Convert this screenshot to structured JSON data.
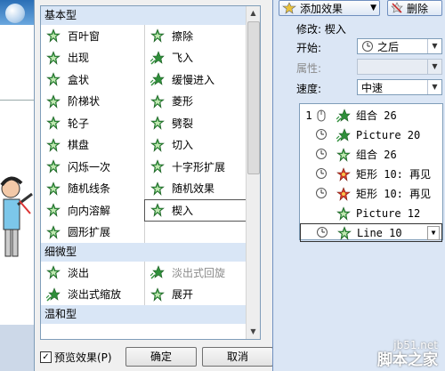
{
  "dialog": {
    "sections": [
      {
        "title": "基本型",
        "items": [
          {
            "label": "百叶窗",
            "icon": "star-effect-icon"
          },
          {
            "label": "擦除",
            "icon": "star-effect-icon"
          },
          {
            "label": "出现",
            "icon": "star-effect-icon"
          },
          {
            "label": "飞入",
            "icon": "star-fly-icon"
          },
          {
            "label": "盒状",
            "icon": "star-effect-icon"
          },
          {
            "label": "缓慢进入",
            "icon": "star-fly-icon"
          },
          {
            "label": "阶梯状",
            "icon": "star-effect-icon"
          },
          {
            "label": "菱形",
            "icon": "star-effect-icon"
          },
          {
            "label": "轮子",
            "icon": "star-effect-icon"
          },
          {
            "label": "劈裂",
            "icon": "star-effect-icon"
          },
          {
            "label": "棋盘",
            "icon": "star-effect-icon"
          },
          {
            "label": "切入",
            "icon": "star-effect-icon"
          },
          {
            "label": "闪烁一次",
            "icon": "star-effect-icon"
          },
          {
            "label": "十字形扩展",
            "icon": "star-effect-icon"
          },
          {
            "label": "随机线条",
            "icon": "star-effect-icon"
          },
          {
            "label": "随机效果",
            "icon": "star-effect-icon"
          },
          {
            "label": "向内溶解",
            "icon": "star-effect-icon"
          },
          {
            "label": "楔入",
            "icon": "star-effect-icon",
            "selected": true
          },
          {
            "label": "圆形扩展",
            "icon": "star-effect-icon"
          },
          {
            "label": "",
            "icon": ""
          }
        ]
      },
      {
        "title": "细微型",
        "items": [
          {
            "label": "淡出",
            "icon": "star-effect-icon"
          },
          {
            "label": "淡出式回旋",
            "icon": "star-fly-icon",
            "disabled": true
          },
          {
            "label": "淡出式缩放",
            "icon": "star-fly-icon"
          },
          {
            "label": "展开",
            "icon": "star-effect-icon"
          }
        ]
      },
      {
        "title": "温和型",
        "items": []
      }
    ],
    "preview_label": "预览效果(P)",
    "preview_checked": true,
    "ok_label": "确定",
    "cancel_label": "取消"
  },
  "pane": {
    "add_effect_label": "添加效果",
    "remove_label": "删除",
    "modify_label": "修改: 楔入",
    "start_label": "开始:",
    "start_value": "之后",
    "property_label": "属性:",
    "property_value": "",
    "speed_label": "速度:",
    "speed_value": "中速",
    "sequence": [
      {
        "num": "1",
        "trigger": "mouse-icon",
        "icon": "star-fly-icon",
        "name": "组合 26"
      },
      {
        "num": "",
        "trigger": "clock-icon",
        "icon": "star-fly-icon",
        "name": "Picture 20"
      },
      {
        "num": "",
        "trigger": "clock-icon",
        "icon": "star-effect-icon",
        "name": "组合 26"
      },
      {
        "num": "",
        "trigger": "clock-icon",
        "icon": "star-burst-icon",
        "name": "矩形 10: 再见"
      },
      {
        "num": "",
        "trigger": "clock-icon",
        "icon": "star-burst-icon",
        "name": "矩形 10: 再见"
      },
      {
        "num": "",
        "trigger": "",
        "icon": "star-effect-icon",
        "name": "Picture 12"
      },
      {
        "num": "",
        "trigger": "clock-icon",
        "icon": "star-effect-icon",
        "name": "Line 10",
        "selected": true
      }
    ]
  },
  "watermark": {
    "site": "jb51.net",
    "brand": "脚本之家"
  }
}
